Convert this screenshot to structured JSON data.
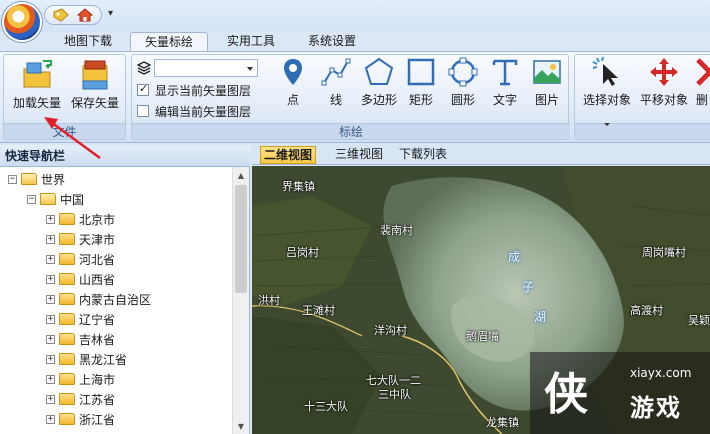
{
  "quick_access": {
    "items": [
      "tag-icon",
      "home-icon"
    ],
    "more": "▾"
  },
  "ribbon_tabs": [
    "地图下载",
    "矢量标绘",
    "实用工具",
    "系统设置"
  ],
  "active_tab": "矢量标绘",
  "groups": {
    "file": {
      "label": "文件",
      "buttons": [
        "加载矢量",
        "保存矢量"
      ]
    },
    "layer": {
      "current_layer": "",
      "show_label": "显示当前矢量图层",
      "show_checked": true,
      "edit_label": "编辑当前矢量图层",
      "edit_checked": false
    },
    "plot": {
      "label": "标绘",
      "buttons": [
        "点",
        "线",
        "多边形",
        "矩形",
        "圆形",
        "文字",
        "图片"
      ]
    },
    "edit": {
      "buttons": [
        "选择对象",
        "平移对象",
        "删"
      ]
    }
  },
  "nav": {
    "title": "快速导航栏",
    "root": "世界",
    "country": "中国",
    "provinces": [
      "北京市",
      "天津市",
      "河北省",
      "山西省",
      "内蒙古自治区",
      "辽宁省",
      "吉林省",
      "黑龙江省",
      "上海市",
      "江苏省",
      "浙江省"
    ]
  },
  "map_tabs": [
    "二维视图",
    "三维视图",
    "下载列表"
  ],
  "active_map_tab": "二维视图",
  "map_labels": [
    "界集镇",
    "裴南村",
    "吕岗村",
    "周岗嘴村",
    "洪村",
    "王滩村",
    "高渡村",
    "洋沟村",
    "鹅眉嘴",
    "吴颖",
    "七大队一二",
    "三中队",
    "十三大队",
    "龙集镇"
  ],
  "lake_chars": [
    "成",
    "子",
    "湖"
  ],
  "watermark": {
    "logo": "侠",
    "site": "xiayx.com",
    "name": "游戏"
  },
  "colors": {
    "accent": "#2f6db5",
    "tab_active": "#f9c94b",
    "ribbon_bg": "#dfe9f6",
    "annotation": "#e0202a"
  }
}
